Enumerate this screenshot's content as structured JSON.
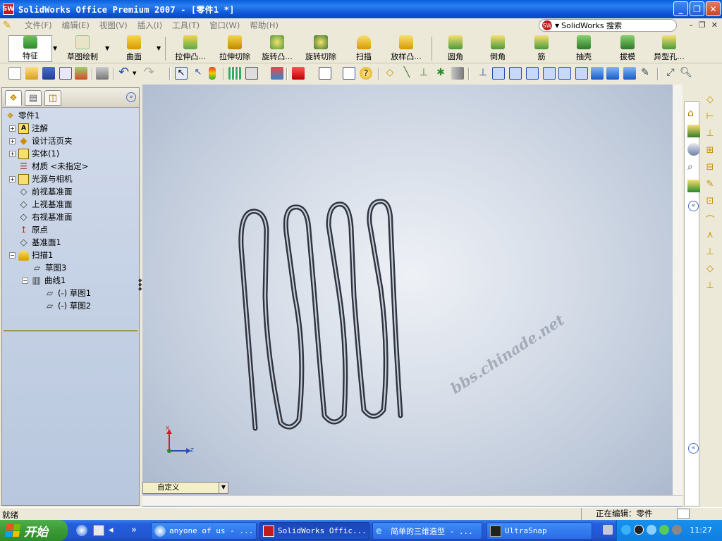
{
  "window": {
    "title": "SolidWorks Office Premium 2007 - [零件1 *]",
    "app_icon": "SW"
  },
  "menu": {
    "items": [
      "文件(F)",
      "编辑(E)",
      "视图(V)",
      "插入(I)",
      "工具(T)",
      "窗口(W)",
      "帮助(H)"
    ],
    "search_label": "SolidWorks 搜索"
  },
  "command_manager": {
    "items": [
      {
        "label": "特征"
      },
      {
        "label": "草图绘制"
      },
      {
        "label": "曲面"
      },
      {
        "label": "拉伸凸..."
      },
      {
        "label": "拉伸切除"
      },
      {
        "label": "旋转凸..."
      },
      {
        "label": "旋转切除"
      },
      {
        "label": "扫描"
      },
      {
        "label": "放样凸..."
      },
      {
        "label": "圆角"
      },
      {
        "label": "倒角"
      },
      {
        "label": "筋"
      },
      {
        "label": "抽壳"
      },
      {
        "label": "拔模"
      },
      {
        "label": "异型孔..."
      }
    ]
  },
  "feature_tree": {
    "root": "零件1",
    "nodes": [
      {
        "label": "注解"
      },
      {
        "label": "设计活页夹"
      },
      {
        "label": "实体(1)"
      },
      {
        "label": "材质 <未指定>"
      },
      {
        "label": "光源与相机"
      },
      {
        "label": "前视基准面"
      },
      {
        "label": "上视基准面"
      },
      {
        "label": "右视基准面"
      },
      {
        "label": "原点"
      },
      {
        "label": "基准面1"
      },
      {
        "label": "扫描1"
      },
      {
        "label": "草图3"
      },
      {
        "label": "曲线1"
      },
      {
        "label": "(-) 草图1"
      },
      {
        "label": "(-) 草图2"
      }
    ]
  },
  "viewport": {
    "watermark": "bbs.chinade.net",
    "triad": {
      "x": "x",
      "y": "y",
      "z": "z"
    }
  },
  "configuration": {
    "selected": "自定义"
  },
  "status": {
    "left": "就绪",
    "right": "正在编辑：零件"
  },
  "taskbar": {
    "start": "开始",
    "tasks": [
      {
        "label": "anyone of us - ..."
      },
      {
        "label": "SolidWorks Offic..."
      },
      {
        "label": "简单的三维造型 - ..."
      },
      {
        "label": "UltraSnap"
      }
    ],
    "clock": "11:27"
  }
}
